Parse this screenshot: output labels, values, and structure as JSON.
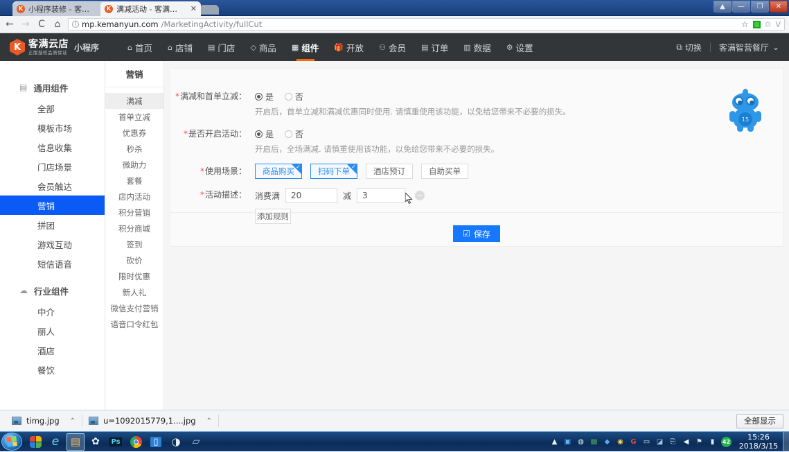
{
  "browser": {
    "tabs": [
      {
        "title": "小程序装修 - 客满云店",
        "favicon_letter": "K",
        "close": "✕",
        "active": false
      },
      {
        "title": "满减活动 - 客满云店",
        "favicon_letter": "K",
        "close": "✕",
        "active": true
      }
    ],
    "window_controls": {
      "restore_down": "▲",
      "minimize": "—",
      "maximize": "❐",
      "close": "✕"
    },
    "nav": {
      "back": "←",
      "forward": "→",
      "reload": "C",
      "home": "⌂"
    },
    "url": {
      "info_icon": "i",
      "host": "mp.kemanyun.com",
      "path": "/MarketingActivity/fullCut",
      "star_icon": "☆",
      "extension_green_icon": "green-square",
      "extension_gear_icon": "⚙",
      "extension_v_icon": "V"
    }
  },
  "topnav": {
    "logo": {
      "mark": "K",
      "name": "客满云店",
      "slogan": "正版授权品质保证",
      "product": "小程序"
    },
    "items": [
      {
        "label": "首页",
        "icon": "⌂",
        "active": false
      },
      {
        "label": "店铺",
        "icon": "⌂",
        "active": false
      },
      {
        "label": "门店",
        "icon": "▤",
        "active": false
      },
      {
        "label": "商品",
        "icon": "◇",
        "active": false
      },
      {
        "label": "组件",
        "icon": "▦",
        "active": true
      },
      {
        "label": "开放",
        "icon": "🎁",
        "active": false
      },
      {
        "label": "会员",
        "icon": "⚇",
        "active": false
      },
      {
        "label": "订单",
        "icon": "▤",
        "active": false
      },
      {
        "label": "数据",
        "icon": "▥",
        "active": false
      },
      {
        "label": "设置",
        "icon": "⚙",
        "active": false
      }
    ],
    "switch_label": "切换",
    "switch_icon": "⧉",
    "user_name": "客满智营餐厅",
    "user_caret": "⌄"
  },
  "sidebar": {
    "groups": [
      {
        "title": "通用组件",
        "icon": "▤",
        "items": [
          {
            "label": "全部",
            "selected": false
          },
          {
            "label": "模板市场",
            "selected": false
          },
          {
            "label": "信息收集",
            "selected": false
          },
          {
            "label": "门店场景",
            "selected": false
          },
          {
            "label": "会员触达",
            "selected": false
          },
          {
            "label": "营销",
            "selected": true
          },
          {
            "label": "拼团",
            "selected": false
          },
          {
            "label": "游戏互动",
            "selected": false
          },
          {
            "label": "短信语音",
            "selected": false
          }
        ]
      },
      {
        "title": "行业组件",
        "icon": "☁",
        "items": [
          {
            "label": "中介",
            "selected": false
          },
          {
            "label": "丽人",
            "selected": false
          },
          {
            "label": "酒店",
            "selected": false
          },
          {
            "label": "餐饮",
            "selected": false
          }
        ]
      }
    ]
  },
  "submenu": {
    "title": "营销",
    "items": [
      {
        "label": "满减",
        "selected": true
      },
      {
        "label": "首单立减",
        "selected": false
      },
      {
        "label": "优惠券",
        "selected": false
      },
      {
        "label": "秒杀",
        "selected": false
      },
      {
        "label": "微助力",
        "selected": false
      },
      {
        "label": "套餐",
        "selected": false
      },
      {
        "label": "店内活动",
        "selected": false
      },
      {
        "label": "积分营销",
        "selected": false
      },
      {
        "label": "积分商城",
        "selected": false
      },
      {
        "label": "签到",
        "selected": false
      },
      {
        "label": "砍价",
        "selected": false
      },
      {
        "label": "限时优惠",
        "selected": false
      },
      {
        "label": "新人礼",
        "selected": false
      },
      {
        "label": "微信支付营销",
        "selected": false
      },
      {
        "label": "语音口令红包",
        "selected": false
      }
    ]
  },
  "form": {
    "row1": {
      "label": "满减和首单立减：",
      "required_mark": "*",
      "options": [
        {
          "label": "是",
          "checked": true
        },
        {
          "label": "否",
          "checked": false
        }
      ],
      "hint": "开启后，首单立减和满减优惠同时使用. 请慎重使用该功能，以免给您带来不必要的损失。"
    },
    "row2": {
      "label": "是否开启活动：",
      "required_mark": "*",
      "options": [
        {
          "label": "是",
          "checked": true
        },
        {
          "label": "否",
          "checked": false
        }
      ],
      "hint": "开启后，全场满减. 请慎重使用该功能，以免给您带来不必要的损失。"
    },
    "row3": {
      "label": "使用场景：",
      "required_mark": "*",
      "scenes": [
        {
          "label": "商品购买",
          "selected": true,
          "check": "✓"
        },
        {
          "label": "扫码下单",
          "selected": true,
          "check": "✓"
        },
        {
          "label": "酒店预订",
          "selected": false,
          "check": ""
        },
        {
          "label": "自助买单",
          "selected": false,
          "check": ""
        }
      ]
    },
    "row4": {
      "label": "活动描述：",
      "required_mark": "*",
      "prefix_text": "消费满",
      "amount_value": "20",
      "middle_text": "减",
      "discount_value": "3",
      "remove_icon": "−",
      "add_rule_label": "添加规则"
    },
    "save": {
      "label": "保存",
      "icon": "☑"
    }
  },
  "mascot": {
    "badge_text": "15"
  },
  "download_bar": {
    "items": [
      {
        "filename": "timg.jpg",
        "caret": "⌃"
      },
      {
        "filename": "u=1092015779,1....jpg",
        "caret": "⌃"
      }
    ],
    "show_all_label": "全部显示"
  },
  "taskbar": {
    "quick_launch": [
      {
        "name": "ie-icon",
        "glyph": "e"
      },
      {
        "name": "folder-icon",
        "glyph": "▭"
      },
      {
        "name": "app-tree-icon",
        "glyph": "✿"
      },
      {
        "name": "photoshop-icon",
        "glyph": "Ps"
      },
      {
        "name": "chrome-icon",
        "glyph": "◉"
      },
      {
        "name": "phone-app-icon",
        "glyph": "▯"
      },
      {
        "name": "obs-icon",
        "glyph": "◑"
      },
      {
        "name": "window-icon",
        "glyph": "▱"
      }
    ],
    "tray_icons": [
      "▣",
      "◍",
      "▤",
      "◆",
      "◉",
      "G",
      "▭",
      "◪",
      "⎘",
      "◀"
    ],
    "notification_count": "42",
    "time": "15:26",
    "date": "2018/3/15"
  }
}
